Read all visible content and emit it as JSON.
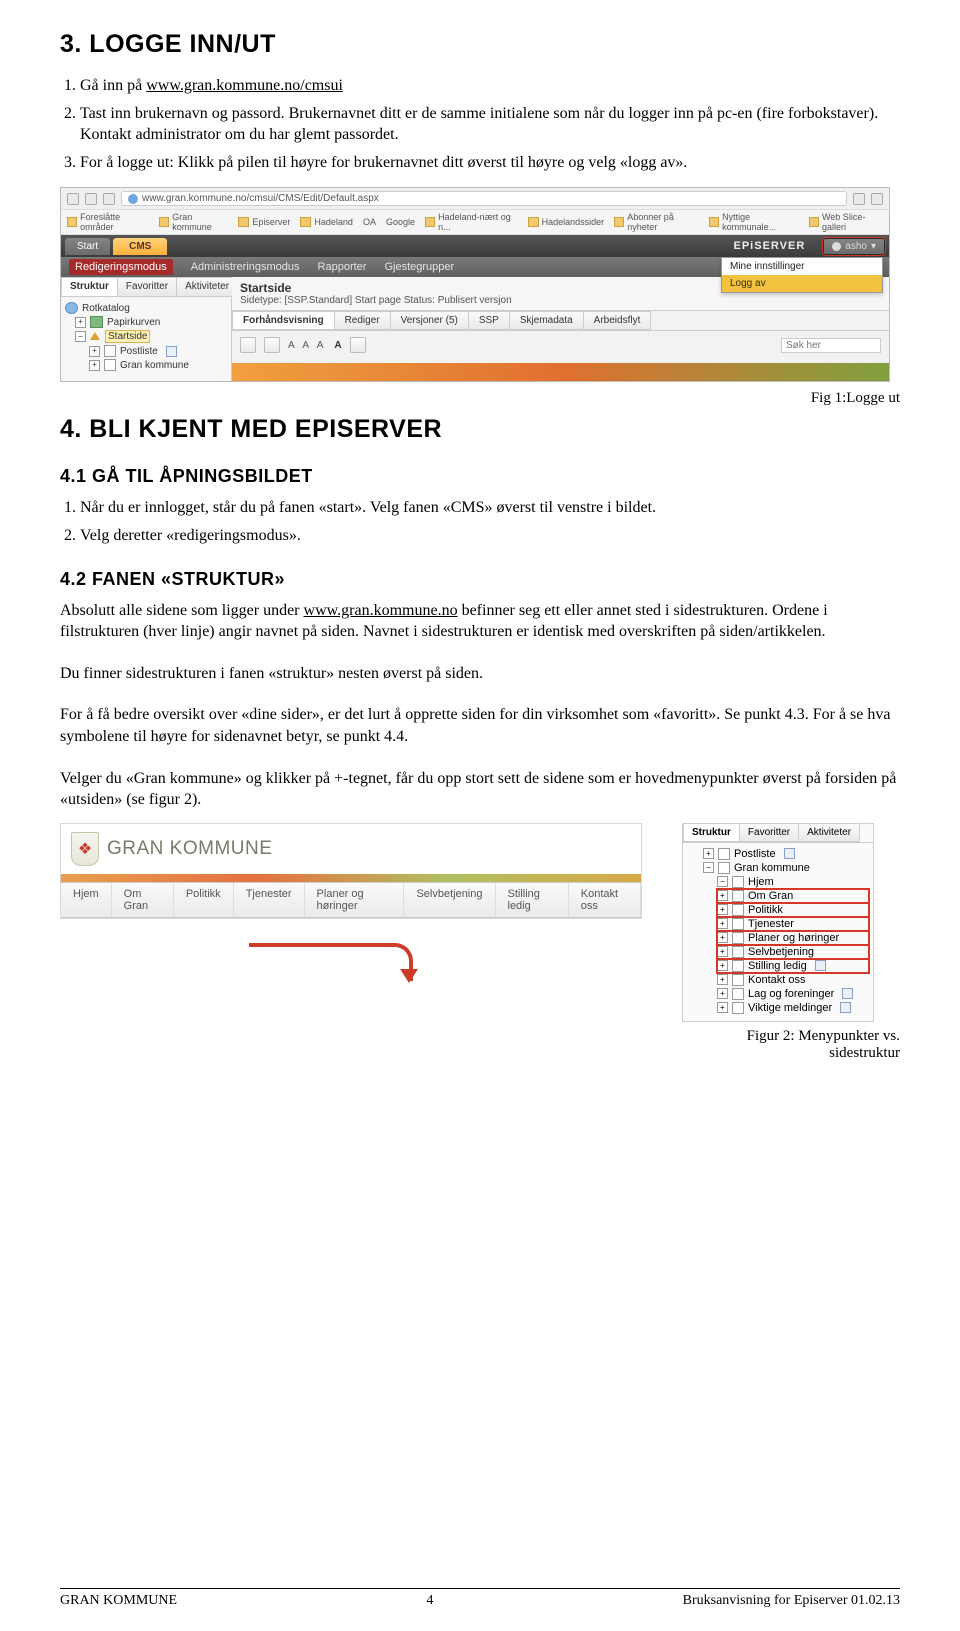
{
  "sections": {
    "s3_title": "3. LOGGE INN/UT",
    "s3_items": {
      "i1_a": "Gå inn på ",
      "i1_link": "www.gran.kommune.no/cmsui",
      "i2": "Tast inn brukernavn og passord. Brukernavnet ditt er de samme initialene som når du logger inn på pc-en (fire forbokstaver). Kontakt administrator om du har glemt passordet.",
      "i3": "For å logge ut: Klikk på pilen til høyre for brukernavnet ditt øverst til høyre og velg «logg av»."
    },
    "fig1": "Fig 1:Logge ut",
    "s4_title": "4. BLI KJENT MED EPISERVER",
    "s41_title": "4.1 GÅ TIL ÅPNINGSBILDET",
    "s41_items": {
      "i1": "Når du er innlogget, står du på fanen «start». Velg fanen «CMS» øverst til venstre i bildet.",
      "i2": "Velg deretter «redigeringsmodus»."
    },
    "s42_title": "4.2 FANEN «STRUKTUR»",
    "s42_p1_a": "Absolutt alle sidene som ligger under ",
    "s42_p1_link": "www.gran.kommune.no",
    "s42_p1_b": " befinner seg ett eller annet sted i sidestrukturen. Ordene i filstrukturen (hver linje) angir navnet på siden. Navnet i sidestrukturen er identisk med overskriften på siden/artikkelen.",
    "s42_p2": "Du finner sidestrukturen i fanen «struktur» nesten øverst på siden.",
    "s42_p3": "For å få bedre oversikt over «dine sider», er det lurt å opprette siden for din virksomhet som «favoritt». Se punkt 4.3. For å se hva symbolene til høyre for sidenavnet betyr, se punkt 4.4.",
    "s42_p4": "Velger du «Gran kommune» og klikker på +-tegnet, får du opp stort sett de sidene som er hovedmenypunkter øverst på forsiden på «utsiden» (se figur 2).",
    "fig2": "Figur 2: Menypunkter vs. sidestruktur"
  },
  "sshot1": {
    "url": "www.gran.kommune.no/cmsui/CMS/Edit/Default.aspx",
    "bookmarks": [
      "Foreslåtte områder",
      "Gran kommune",
      "Episerver",
      "Hadeland",
      "OA",
      "Google",
      "Hadeland-nært og n...",
      "Hadelandssider",
      "Abonner på nyheter",
      "Nyttige kommunale...",
      "Web Slice-galleri"
    ],
    "tab_start": "Start",
    "tab_cms": "CMS",
    "episerver": "EPiSERVER",
    "user": "asho",
    "modes": [
      "Redigeringsmodus",
      "Administreringsmodus",
      "Rapporter",
      "Gjestegrupper"
    ],
    "dropdown": {
      "one": "Mine innstillinger",
      "two": "Logg av"
    },
    "left_tabs": [
      "Struktur",
      "Favoritter",
      "Aktiviteter"
    ],
    "tree": {
      "root": "Rotkatalog",
      "bin": "Papirkurven",
      "start": "Startside",
      "postliste": "Postliste",
      "gk": "Gran kommune"
    },
    "right": {
      "title": "Startside",
      "sub": "Sidetype: [SSP.Standard] Start page   Status: Publisert versjon",
      "tabs": [
        "Forhåndsvisning",
        "Rediger",
        "Versjoner (5)",
        "SSP",
        "Skjemadata",
        "Arbeidsflyt"
      ],
      "fontsamples": "A A A",
      "fontbold": "A",
      "search": "Søk her"
    }
  },
  "gk": {
    "name": "GRAN KOMMUNE",
    "nav": [
      "Hjem",
      "Om Gran",
      "Politikk",
      "Tjenester",
      "Planer og høringer",
      "Selvbetjening",
      "Stilling ledig",
      "Kontakt oss"
    ]
  },
  "sidetree": {
    "tabs": [
      "Struktur",
      "Favoritter",
      "Aktiviteter"
    ],
    "items": [
      {
        "indent": 1,
        "sym": "+",
        "label": "Postliste",
        "ext": true,
        "hl": false
      },
      {
        "indent": 1,
        "sym": "-",
        "label": "Gran kommune",
        "ext": false,
        "hl": false
      },
      {
        "indent": 2,
        "sym": "-",
        "label": "Hjem",
        "ext": false,
        "hl": false
      },
      {
        "indent": 2,
        "sym": "+",
        "label": "Om Gran",
        "ext": false,
        "hl": true
      },
      {
        "indent": 2,
        "sym": "+",
        "label": "Politikk",
        "ext": false,
        "hl": true
      },
      {
        "indent": 2,
        "sym": "+",
        "label": "Tjenester",
        "ext": false,
        "hl": true
      },
      {
        "indent": 2,
        "sym": "+",
        "label": "Planer og høringer",
        "ext": false,
        "hl": true
      },
      {
        "indent": 2,
        "sym": "+",
        "label": "Selvbetjening",
        "ext": false,
        "hl": true
      },
      {
        "indent": 2,
        "sym": "+",
        "label": "Stilling ledig",
        "ext": true,
        "hl": true
      },
      {
        "indent": 2,
        "sym": "+",
        "label": "Kontakt oss",
        "ext": false,
        "hl": false
      },
      {
        "indent": 2,
        "sym": "+",
        "label": "Lag og foreninger",
        "ext": true,
        "hl": false
      },
      {
        "indent": 2,
        "sym": "+",
        "label": "Viktige meldinger",
        "ext": true,
        "hl": false
      }
    ]
  },
  "footer": {
    "left": "GRAN KOMMUNE",
    "center": "4",
    "right": "Bruksanvisning for Episerver 01.02.13"
  }
}
